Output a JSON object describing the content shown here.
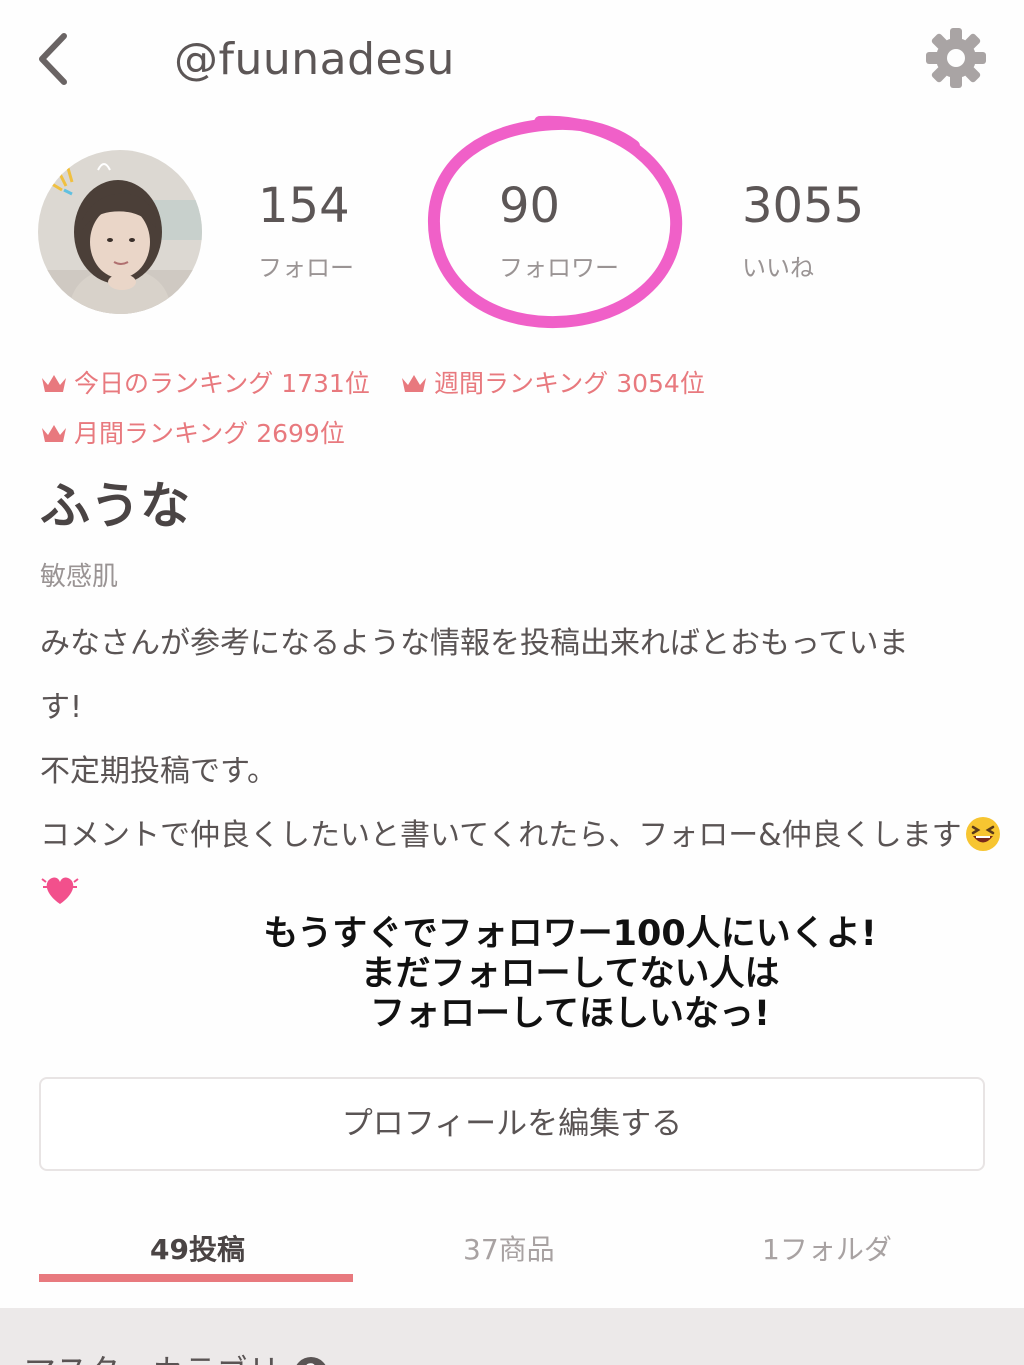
{
  "header": {
    "username": "@fuunadesu",
    "back_icon": "chevron-left-icon",
    "settings_icon": "gear-icon"
  },
  "stats": {
    "following_count": "154",
    "following_label": "フォロー",
    "followers_count": "90",
    "followers_label": "フォロワー",
    "likes_count": "3055",
    "likes_label": "いいね"
  },
  "rankings": {
    "daily": "今日のランキング 1731位",
    "weekly": "週間ランキング 3054位",
    "monthly": "月間ランキング 2699位"
  },
  "profile": {
    "display_name": "ふうな",
    "skin_type": "敏感肌",
    "bio_lines": [
      "みなさんが参考になるような情報を投稿出来ればとおもっていま",
      "す!",
      "不定期投稿です。",
      "コメントで仲良くしたいと書いてくれたら、フォロー&仲良くします"
    ]
  },
  "overlay": {
    "line1": "もうすぐでフォロワー100人にいくよ!",
    "line2": "まだフォローしてない人は",
    "line3": "フォローしてほしいなっ!"
  },
  "edit_button_label": "プロフィールを編集する",
  "tabs": {
    "posts": "49投稿",
    "products": "37商品",
    "folders": "1フォルダ"
  },
  "bottom": {
    "title": "マスターカテゴリ",
    "help": "?"
  },
  "colors": {
    "accent": "#e8797e",
    "highlight_circle": "#f060c8",
    "text": "#5a5454",
    "muted": "#9a9494"
  }
}
